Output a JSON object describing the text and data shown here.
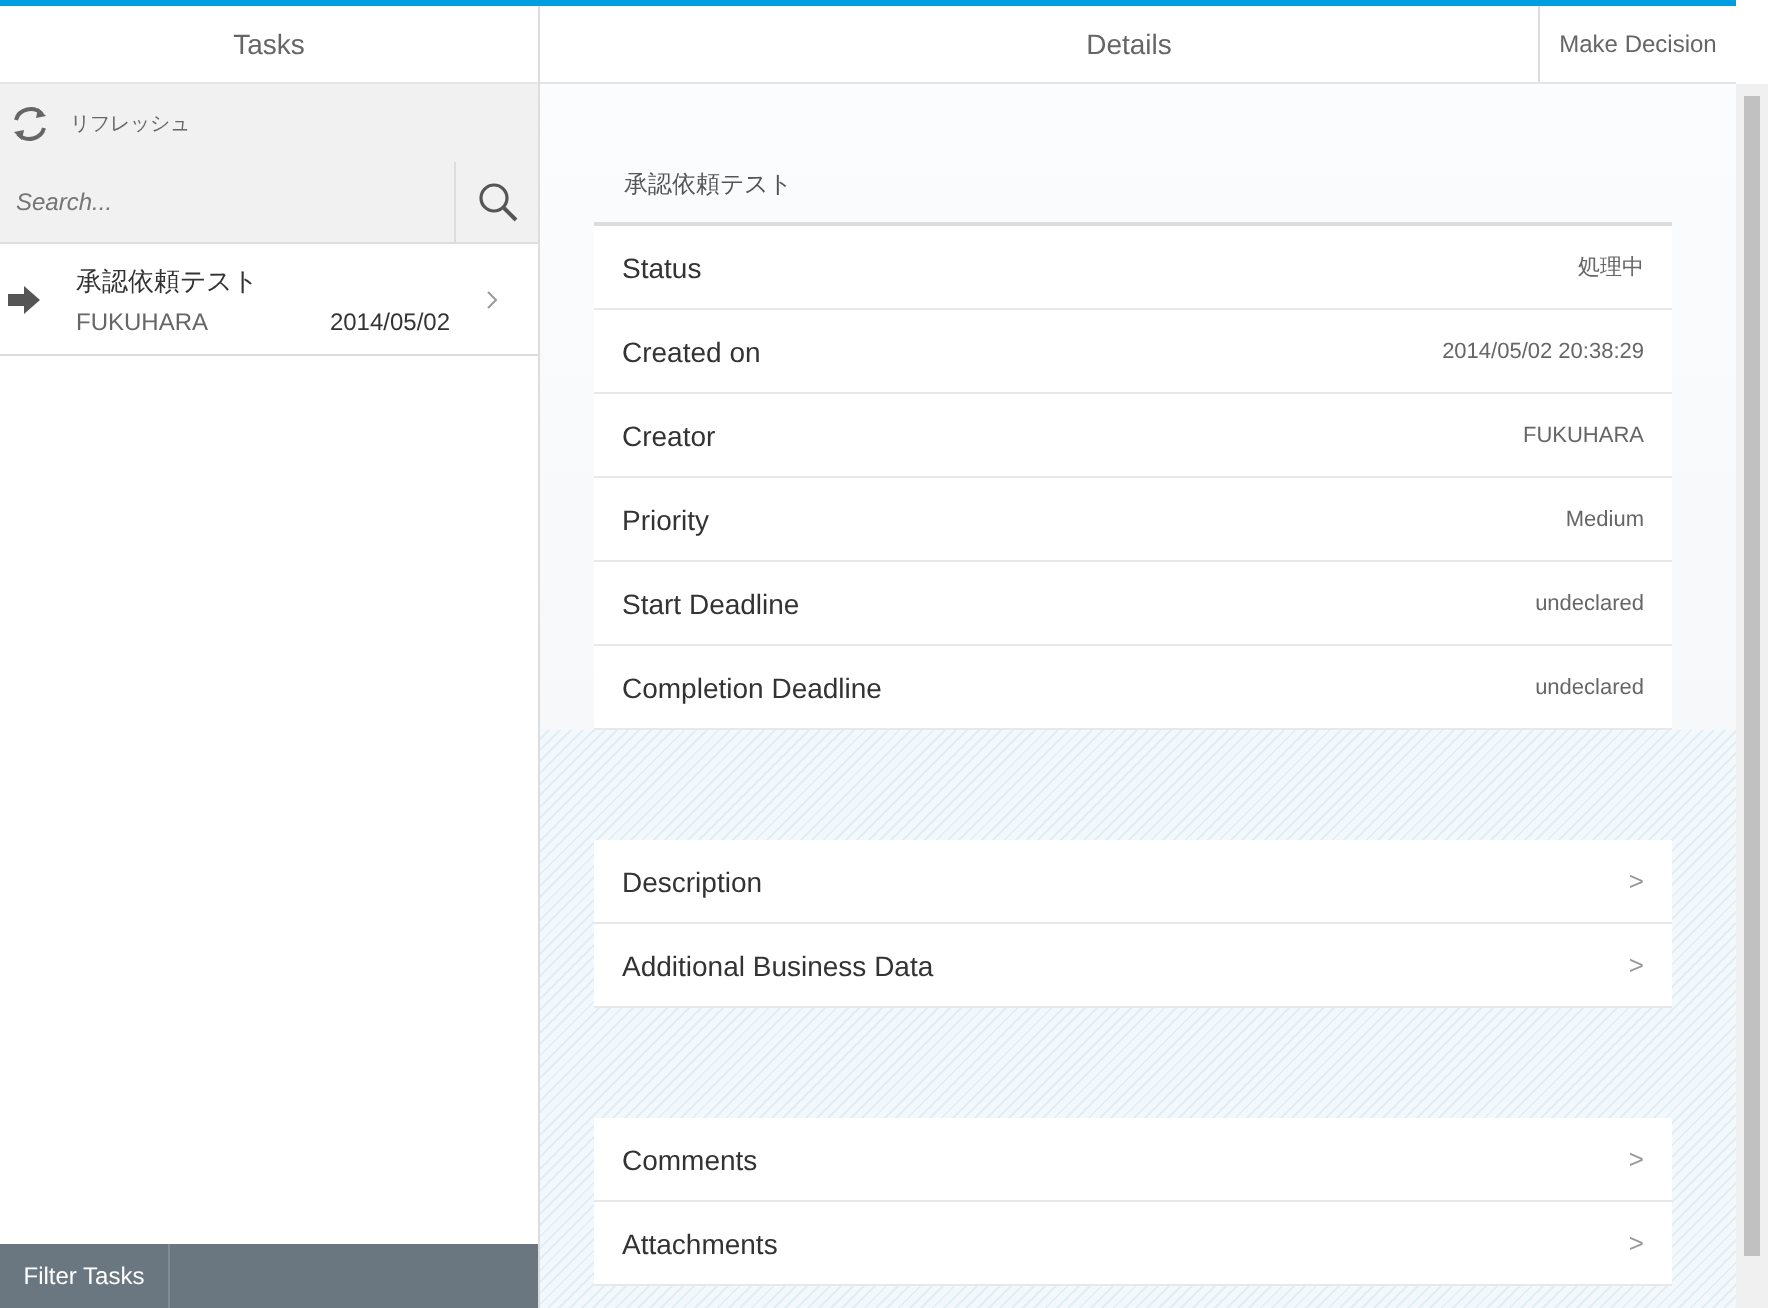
{
  "master": {
    "title": "Tasks",
    "refresh_label": "リフレッシュ",
    "search": {
      "placeholder": "Search..."
    },
    "tasks": [
      {
        "title": "承認依頼テスト",
        "creator": "FUKUHARA",
        "date": "2014/05/02",
        "selected": false
      }
    ],
    "footer_button": "Filter Tasks"
  },
  "detail": {
    "title": "Details",
    "action_button": "Make Decision",
    "task_title": "承認依頼テスト",
    "fields": [
      {
        "label": "Status",
        "value": "処理中"
      },
      {
        "label": "Created on",
        "value": "2014/05/02 20:38:29"
      },
      {
        "label": "Creator",
        "value": "FUKUHARA"
      },
      {
        "label": "Priority",
        "value": "Medium"
      },
      {
        "label": "Start Deadline",
        "value": "undeclared"
      },
      {
        "label": "Completion Deadline",
        "value": "undeclared"
      }
    ],
    "link_groups": [
      [
        {
          "label": "Description",
          "chevron": ">"
        },
        {
          "label": "Additional Business Data",
          "chevron": ">"
        }
      ],
      [
        {
          "label": "Comments",
          "chevron": ">"
        },
        {
          "label": "Attachments",
          "chevron": ">"
        }
      ]
    ]
  }
}
